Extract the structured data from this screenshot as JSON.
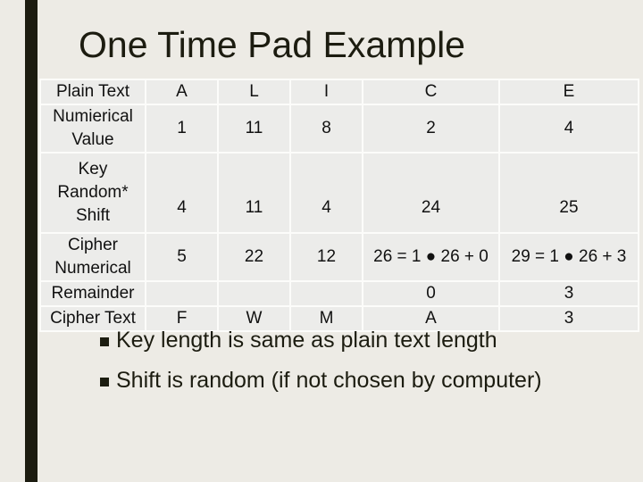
{
  "slide": {
    "title": "One Time Pad Example",
    "accent_bar_color": "#1c1c10",
    "background_color": "#edebe5"
  },
  "table": {
    "rows": [
      {
        "label": "Plain Text",
        "cells": [
          "A",
          "L",
          "I",
          "C",
          "E"
        ]
      },
      {
        "label": "Numierical\nValue",
        "cells": [
          "1",
          "11",
          "8",
          "2",
          "4"
        ]
      },
      {
        "label": "Key\nRandom*\nShift",
        "cells": [
          "4",
          "11",
          "4",
          "24",
          "25"
        ]
      },
      {
        "label": "Cipher\nNumerical",
        "cells": [
          "5",
          "22",
          "12",
          "26 = 1 ● 26 + 0",
          "29 = 1 ● 26 + 3"
        ]
      },
      {
        "label": "Remainder",
        "cells": [
          "",
          "",
          "",
          "0",
          "3"
        ]
      },
      {
        "label": "Cipher Text",
        "cells": [
          "F",
          "W",
          "M",
          "A",
          "3"
        ]
      }
    ]
  },
  "bullets": [
    "Key length is same as plain text length",
    "Shift is random (if not chosen by computer)"
  ]
}
